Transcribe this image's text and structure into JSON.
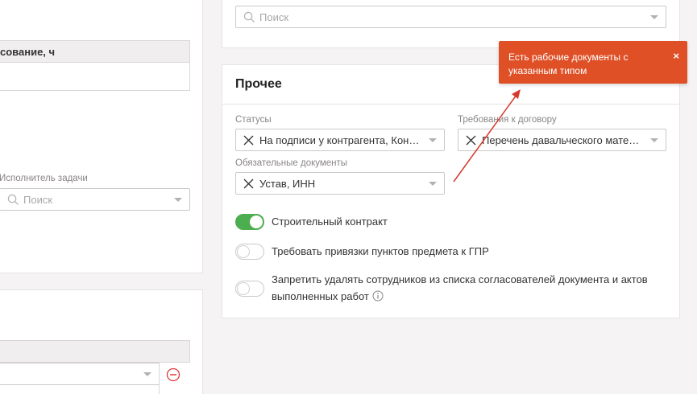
{
  "left": {
    "table_top_header": "сование, ч",
    "assignee_label": "Исполнитель задачи",
    "assignee_placeholder": "Поиск"
  },
  "right_top": {
    "search_placeholder": "Поиск"
  },
  "other_section": {
    "title": "Прочее",
    "statuses_label": "Статусы",
    "statuses_value": "На подписи у контрагента, Контрагент",
    "contract_req_label": "Требования к договору",
    "contract_req_value": "Перечень давальческого материала",
    "required_docs_label": "Обязательные документы",
    "required_docs_value": "Устав, ИНН",
    "toggles": [
      {
        "label": "Строительный контракт",
        "on": true
      },
      {
        "label": "Требовать привязки пунктов предмета к ГПР",
        "on": false
      },
      {
        "label": "Запретить удалять сотрудников из списка согласователей документа и актов выполненных работ",
        "on": false
      }
    ]
  },
  "toast": {
    "message": "Есть рабочие документы с указанным типом",
    "close": "×"
  },
  "colors": {
    "accent_toast": "#df5027",
    "toggle_on": "#4cae4f",
    "annotation_arrow": "#d63a2e"
  }
}
